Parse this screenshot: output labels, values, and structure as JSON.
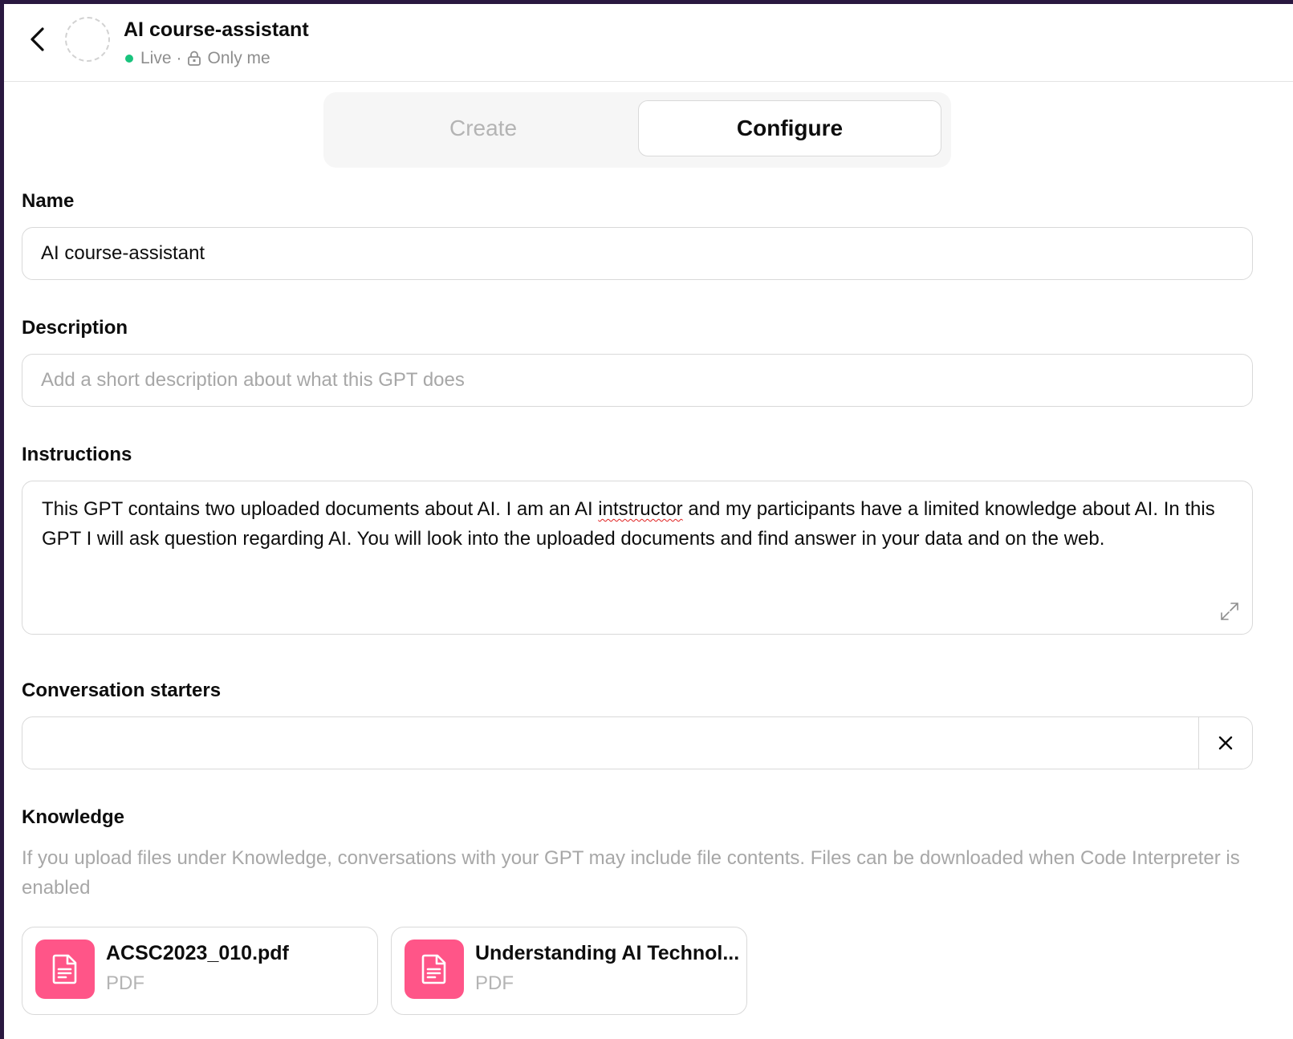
{
  "header": {
    "title": "AI course-assistant",
    "status": "Live",
    "separator": "·",
    "visibility": "Only me"
  },
  "tabs": [
    {
      "label": "Create",
      "active": false
    },
    {
      "label": "Configure",
      "active": true
    }
  ],
  "form": {
    "name": {
      "label": "Name",
      "value": "AI course-assistant"
    },
    "description": {
      "label": "Description",
      "value": "",
      "placeholder": "Add a short description about what this GPT does"
    },
    "instructions": {
      "label": "Instructions",
      "text_before": "This GPT contains two uploaded documents about AI. I am an AI ",
      "misspelled": "intstructor",
      "text_after": " and my participants have a limited knowledge about AI. In this GPT I will ask question regarding AI. You will look into the uploaded documents and find answer in your data and on the web."
    },
    "conversation_starters": {
      "label": "Conversation starters",
      "value": ""
    }
  },
  "knowledge": {
    "label": "Knowledge",
    "note": "If you upload files under Knowledge, conversations with your GPT may include file contents. Files can be downloaded when Code Interpreter is enabled",
    "files": [
      {
        "name": "ACSC2023_010.pdf",
        "type": "PDF"
      },
      {
        "name": "Understanding AI Technol...",
        "type": "PDF"
      }
    ]
  },
  "colors": {
    "live_dot": "#19c37d",
    "file_icon_bg": "#ff5588",
    "spellcheck_underline": "#e02020",
    "backdrop": "#2a1840"
  },
  "icons": {
    "back": "chevron-left-icon",
    "lock": "lock-icon",
    "expand": "expand-icon",
    "clear": "close-icon",
    "file": "document-icon"
  }
}
